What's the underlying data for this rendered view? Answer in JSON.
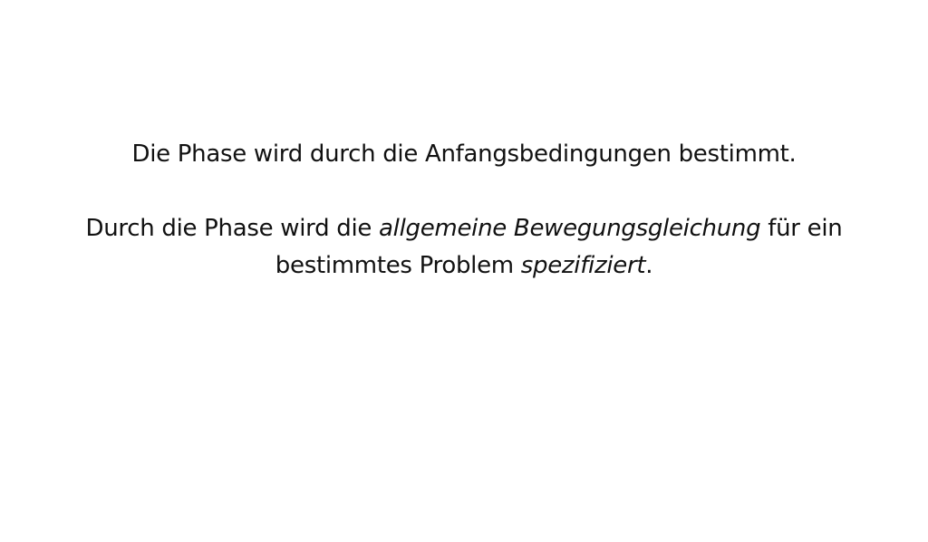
{
  "paragraph_1": {
    "text": "Die Phase wird durch die Anfangsbedingungen bestimmt."
  },
  "paragraph_2": {
    "part_1": "Durch die Phase wird die ",
    "emphasis_1": "allgemeine Bewegungsgleichung",
    "part_2": " für ein bestimmtes Problem ",
    "emphasis_2": "spezifiziert",
    "part_3": "."
  }
}
